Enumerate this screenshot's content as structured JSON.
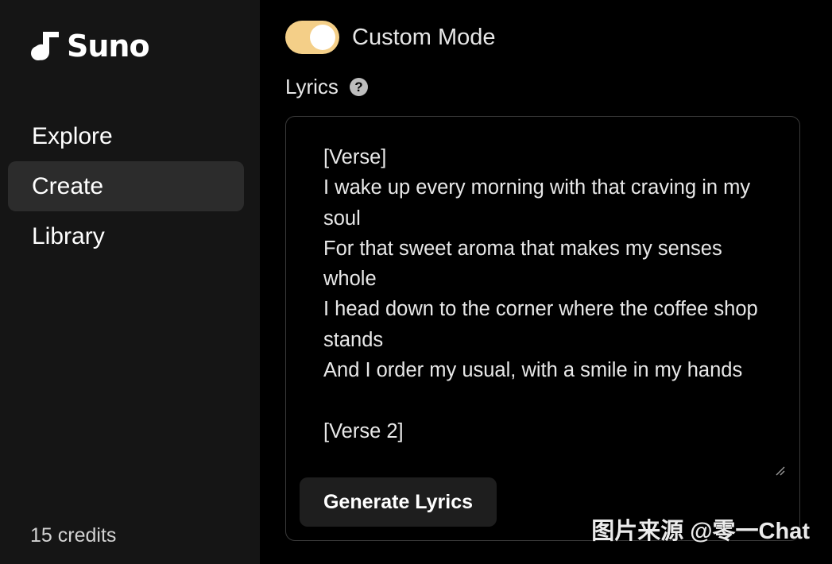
{
  "sidebar": {
    "logo_text": "Suno",
    "nav": [
      {
        "label": "Explore",
        "active": false
      },
      {
        "label": "Create",
        "active": true
      },
      {
        "label": "Library",
        "active": false
      }
    ],
    "credits": "15 credits"
  },
  "main": {
    "custom_mode": {
      "label": "Custom Mode",
      "on": true,
      "color": "#f4cf88"
    },
    "lyrics": {
      "label": "Lyrics",
      "help_icon": "question-circle-icon",
      "text": "[Verse]\nI wake up every morning with that craving in my soul\nFor that sweet aroma that makes my senses whole\nI head down to the corner where the coffee shop stands\nAnd I order my usual, with a smile in my hands\n\n[Verse 2]"
    },
    "generate_button": "Generate Lyrics"
  },
  "watermark": "图片来源 @零一Chat"
}
